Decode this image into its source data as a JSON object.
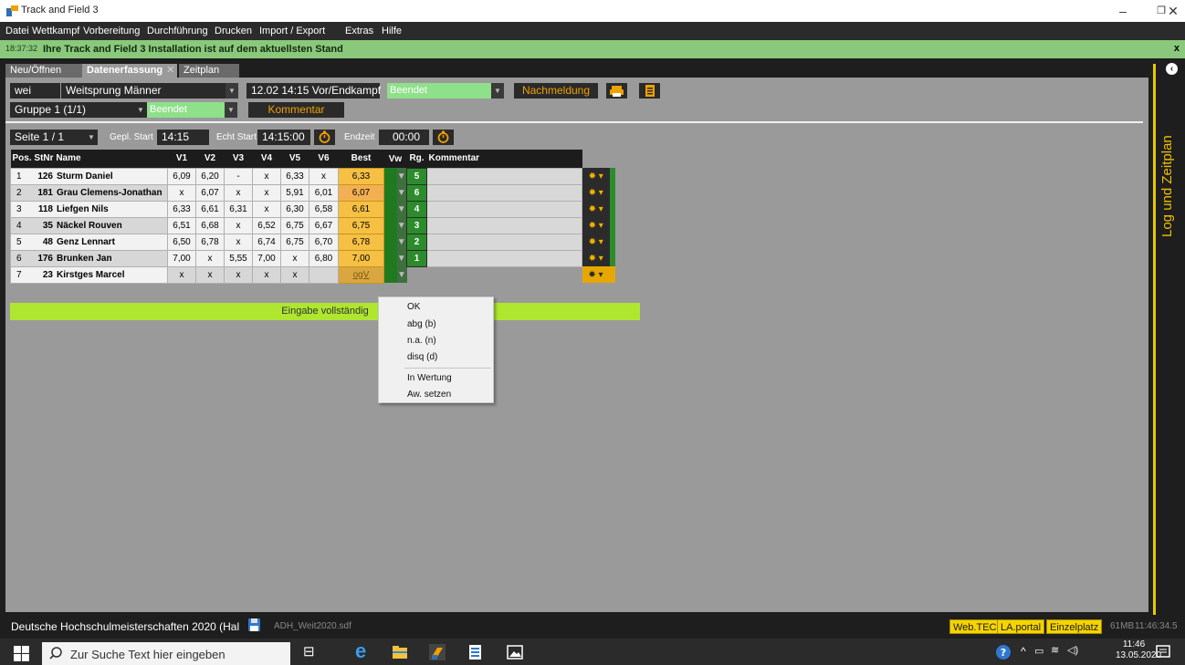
{
  "window": {
    "title": "Track and Field 3"
  },
  "menu": [
    "Datei",
    "Wettkampf",
    "Vorbereitung",
    "Durchführung",
    "Drucken",
    "Import / Export",
    "Extras",
    "Hilfe"
  ],
  "notification": {
    "time": "18:37:32",
    "message": "Ihre Track and Field 3 Installation ist auf dem aktuellsten Stand",
    "close": "x"
  },
  "tabs": {
    "open": "Neu/Öffnen",
    "entry": "Datenerfassung",
    "schedule": "Zeitplan"
  },
  "right_panel": {
    "title": "Log und Zeitplan"
  },
  "event": {
    "code": "wei",
    "name": "Weitsprung Männer",
    "session": "12.02 14:15 Vor/Endkampf",
    "session_status": "Beendet",
    "late_entry": "Nachmeldung",
    "group": "Gruppe 1 (1/1)",
    "group_status": "Beendet",
    "comment_btn": "Kommentar"
  },
  "timing": {
    "page": "Seite 1 / 1",
    "planned_label": "Gepl. Start",
    "planned": "14:15",
    "actual_label": "Echt Start",
    "actual": "14:15:00",
    "end_label": "Endzeit",
    "end": "00:00"
  },
  "table": {
    "headers": {
      "pos": "Pos.",
      "bib": "StNr",
      "name": "Name",
      "v1": "V1",
      "v2": "V2",
      "v3": "V3",
      "v4": "V4",
      "v5": "V5",
      "v6": "V6",
      "best": "Best",
      "vw": "Vw",
      "rank": "Rg.",
      "comment": "Kommentar"
    },
    "rows": [
      {
        "pos": "1",
        "bib": "126",
        "name": "Sturm Daniel",
        "v1": "6,09",
        "v2": "6,20",
        "v3": "-",
        "v4": "x",
        "v5": "6,33",
        "v6": "x",
        "best": "6,33",
        "rank": "5"
      },
      {
        "pos": "2",
        "bib": "181",
        "name": "Grau Clemens-Jonathan",
        "v1": "x",
        "v2": "6,07",
        "v3": "x",
        "v4": "x",
        "v5": "5,91",
        "v6": "6,01",
        "best": "6,07",
        "rank": "6"
      },
      {
        "pos": "3",
        "bib": "118",
        "name": "Liefgen Nils",
        "v1": "6,33",
        "v2": "6,61",
        "v3": "6,31",
        "v4": "x",
        "v5": "6,30",
        "v6": "6,58",
        "best": "6,61",
        "rank": "4"
      },
      {
        "pos": "4",
        "bib": "35",
        "name": "Näckel Rouven",
        "v1": "6,51",
        "v2": "6,68",
        "v3": "x",
        "v4": "6,52",
        "v5": "6,75",
        "v6": "6,67",
        "best": "6,75",
        "rank": "3"
      },
      {
        "pos": "5",
        "bib": "48",
        "name": "Genz Lennart",
        "v1": "6,50",
        "v2": "6,78",
        "v3": "x",
        "v4": "6,74",
        "v5": "6,75",
        "v6": "6,70",
        "best": "6,78",
        "rank": "2"
      },
      {
        "pos": "6",
        "bib": "176",
        "name": "Brunken Jan",
        "v1": "7,00",
        "v2": "x",
        "v3": "5,55",
        "v4": "7,00",
        "v5": "x",
        "v6": "6,80",
        "best": "7,00",
        "rank": "1"
      },
      {
        "pos": "7",
        "bib": "23",
        "name": "Kirstges Marcel",
        "v1": "x",
        "v2": "x",
        "v3": "x",
        "v4": "x",
        "v5": "x",
        "v6": "",
        "best": "ogV",
        "rank": ""
      }
    ],
    "complete_text": "Eingabe vollständig"
  },
  "context_menu": {
    "items": [
      "OK",
      "abg (b)",
      "n.a. (n)",
      "disq (d)",
      "In Wertung",
      "Aw. setzen"
    ]
  },
  "status": {
    "competition": "Deutsche Hochschulmeisterschaften 2020 (Hal",
    "file": "ADH_Weit2020.sdf",
    "tags": [
      "Web.TEC",
      "LA.portal",
      "Einzelplatz"
    ],
    "memory": "61MB",
    "time": "11:46:34.5"
  },
  "taskbar": {
    "search_placeholder": "Zur Suche Text hier eingeben",
    "time": "11:46",
    "date": "13.05.2020"
  },
  "colors": {
    "accent_yellow": "#f0c000",
    "rank_green": "#2c8c2c",
    "best_orange": "#f5c044",
    "complete_lime": "#aee630"
  }
}
